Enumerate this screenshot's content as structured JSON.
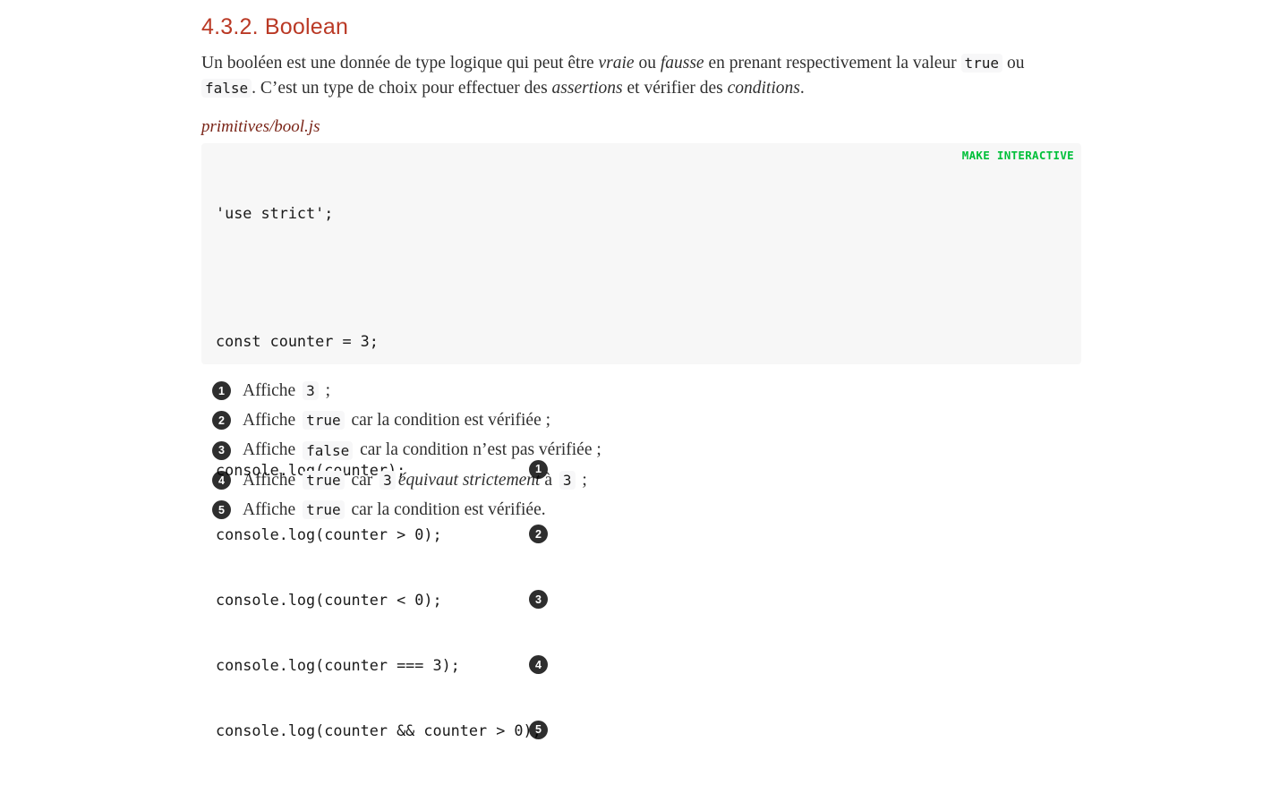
{
  "section": {
    "title": "4.3.2. Boolean"
  },
  "intro": {
    "t1": "Un booléen est une donnée de type logique qui peut être ",
    "e1": "vraie",
    "t2": " ou ",
    "e2": "fausse",
    "t3": " en prenant respectivement la valeur ",
    "c1": "true",
    "t4": " ou ",
    "c2": "false",
    "t5": ". C’est un type de choix pour effectuer des ",
    "e3": "assertions",
    "t6": " et vérifier des ",
    "e4": "conditions",
    "t7": "."
  },
  "listing": {
    "title": "primitives/bool.js",
    "action_label": "MAKE INTERACTIVE",
    "lines": [
      "'use strict';",
      "const counter = 3;",
      "console.log(counter);",
      "console.log(counter > 0);",
      "console.log(counter < 0);",
      "console.log(counter === 3);",
      "console.log(counter && counter > 0);"
    ],
    "callouts": [
      "1",
      "2",
      "3",
      "4",
      "5"
    ]
  },
  "colist": [
    {
      "num": "1",
      "a": "Affiche ",
      "code": "3",
      "b": " ;"
    },
    {
      "num": "2",
      "a": "Affiche ",
      "code": "true",
      "b": " car la condition est vérifiée ;"
    },
    {
      "num": "3",
      "a": "Affiche ",
      "code": "false",
      "b": " car la condition n’est pas vérifiée ;"
    },
    {
      "num": "4",
      "a": "Affiche ",
      "code": "true",
      "b": " car ",
      "code2": "3",
      "em": "équivaut strictement",
      "c": " à ",
      "code3": "3",
      "d": " ;"
    },
    {
      "num": "5",
      "a": "Affiche ",
      "code": "true",
      "b": " car la condition est vérifiée."
    }
  ]
}
